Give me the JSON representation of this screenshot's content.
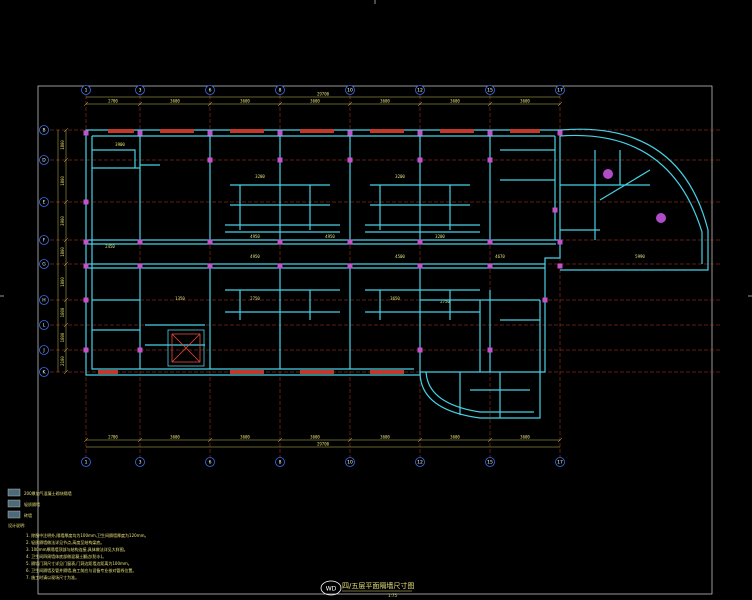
{
  "title": "四/五层平面隔墙尺寸图",
  "scale": "1:75",
  "logo_text": "WD",
  "axes_top": [
    "1",
    "3",
    "6",
    "8",
    "10",
    "12",
    "15",
    "17"
  ],
  "axes_left": [
    "B",
    "D",
    "E",
    "F",
    "G",
    "H",
    "L",
    "J",
    "K"
  ],
  "dims": {
    "overall": "29700",
    "top_row": [
      "2700",
      "3600",
      "3600",
      "3600",
      "3600",
      "3600",
      "3600",
      "3600"
    ],
    "bottom_row": [
      "2700",
      "3600",
      "3600",
      "3600",
      "3600",
      "3600",
      "3600",
      "3600"
    ],
    "left_col": [
      "1800",
      "1800",
      "3900",
      "1800",
      "1800",
      "1800",
      "1800",
      "2100"
    ],
    "interior": [
      "3900",
      "3200",
      "3200",
      "4950",
      "4950",
      "3200",
      "4950",
      "4500",
      "4670",
      "5990",
      "2450",
      "2750",
      "2750",
      "3650",
      "1350"
    ]
  },
  "legend": [
    "200厚加气混凝土砌块隔墙",
    "轻质隔墙",
    "砖墙"
  ],
  "notes_title": "设计说明:",
  "notes": [
    "1. 除图中注明外,隔墙厚度均为100mm,卫生间隔墙厚度为120mm。",
    "2. 轻质隔墙做法详见节点,高度至结构梁底。",
    "3. 100mm厚隔墙顶部与结构连接,具体做法详见大样图。",
    "4. 卫生间四周墙体底部做混凝土翻边(防水)。",
    "5. 隔墙门洞尺寸详见门窗表,门洞边距墙边距离为100mm。",
    "6. 卫生间隔墙及管井隔墙,施工前应与设备专业核对管线位置。",
    "7. 施工时请以现场尺寸为准。"
  ]
}
